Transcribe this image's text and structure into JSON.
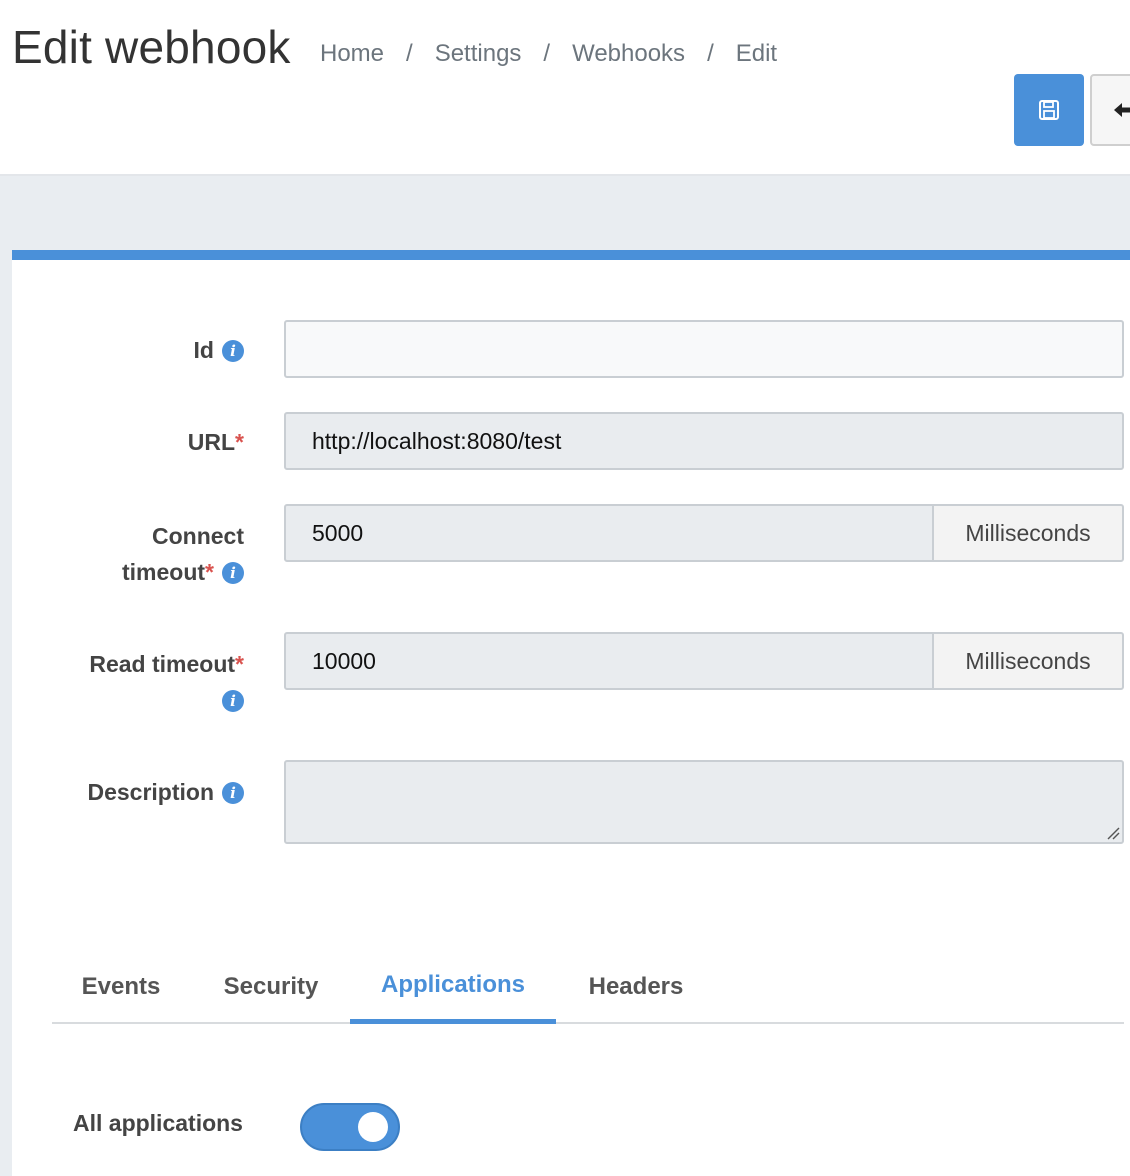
{
  "header": {
    "title": "Edit webhook",
    "breadcrumb": [
      "Home",
      "Settings",
      "Webhooks",
      "Edit"
    ],
    "breadcrumb_separator": "/",
    "save_icon": "floppy-disk-icon",
    "back_icon": "arrow-left-icon"
  },
  "form": {
    "id": {
      "label": "Id",
      "value": "",
      "required": false
    },
    "url": {
      "label": "URL",
      "value": "http://localhost:8080/test",
      "required": true
    },
    "connect_timeout": {
      "label_line1": "Connect",
      "label_line2": "timeout",
      "value": "5000",
      "unit": "Milliseconds",
      "required": true
    },
    "read_timeout": {
      "label": "Read timeout",
      "value": "10000",
      "unit": "Milliseconds",
      "required": true
    },
    "description": {
      "label": "Description",
      "value": ""
    },
    "required_marker": "*",
    "info_glyph": "i"
  },
  "tabs": [
    {
      "label": "Events",
      "active": false
    },
    {
      "label": "Security",
      "active": false
    },
    {
      "label": "Applications",
      "active": true
    },
    {
      "label": "Headers",
      "active": false
    }
  ],
  "applications": {
    "all_label": "All applications",
    "all_enabled": true
  },
  "colors": {
    "accent": "#4a90d9",
    "required": "#d9534f",
    "background": "#e9edf1"
  }
}
